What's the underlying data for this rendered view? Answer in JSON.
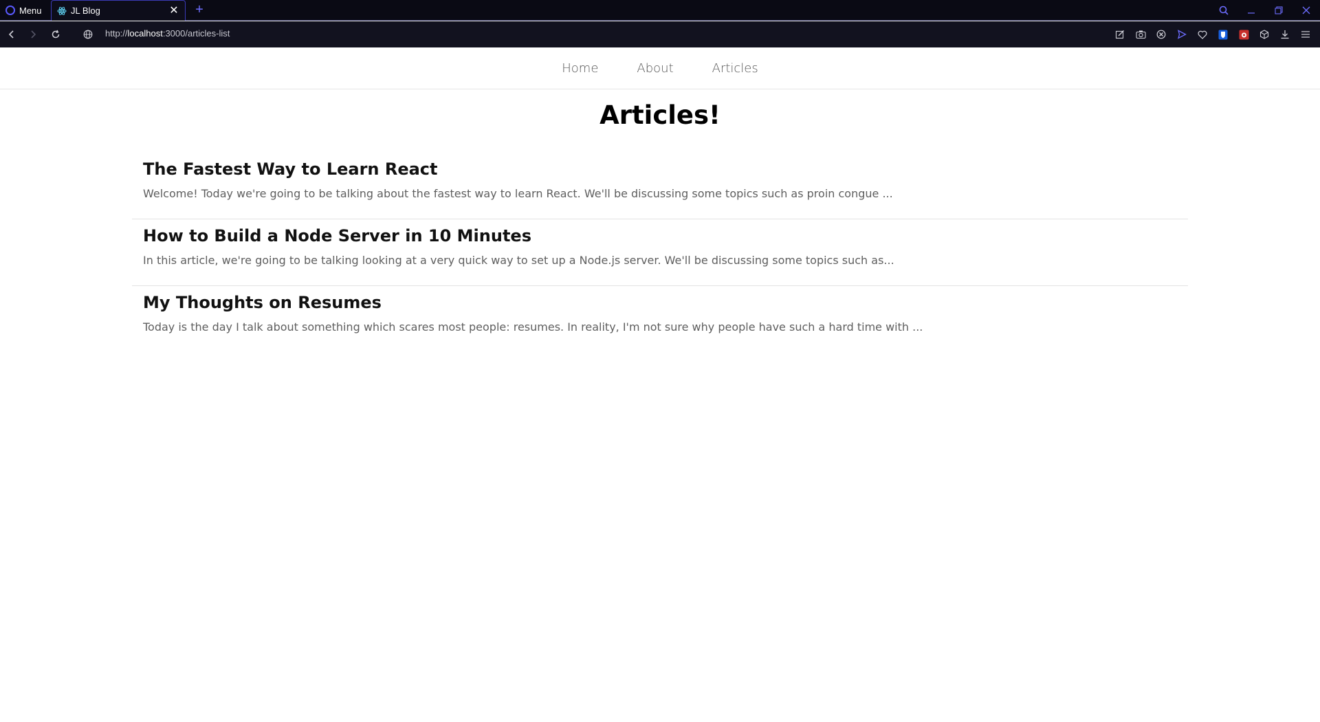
{
  "browser": {
    "menu_label": "Menu",
    "tab": {
      "title": "JL Blog"
    },
    "url": {
      "scheme": "http://",
      "host": "localhost",
      "rest": ":3000/articles-list"
    },
    "accent": "#6d6dff",
    "chrome_bg": "#0a0a14"
  },
  "nav": {
    "items": [
      "Home",
      "About",
      "Articles"
    ]
  },
  "page": {
    "title": "Articles!"
  },
  "articles": [
    {
      "title": "The Fastest Way to Learn React",
      "excerpt": "Welcome! Today we're going to be talking about the fastest way to learn React. We'll be discussing some topics such as proin congue ..."
    },
    {
      "title": "How to Build a Node Server in 10 Minutes",
      "excerpt": "In this article, we're going to be talking looking at a very quick way to set up a Node.js server. We'll be discussing some topics such as..."
    },
    {
      "title": "My Thoughts on Resumes",
      "excerpt": "Today is the day I talk about something which scares most people: resumes. In reality, I'm not sure why people have such a hard time with ..."
    }
  ]
}
